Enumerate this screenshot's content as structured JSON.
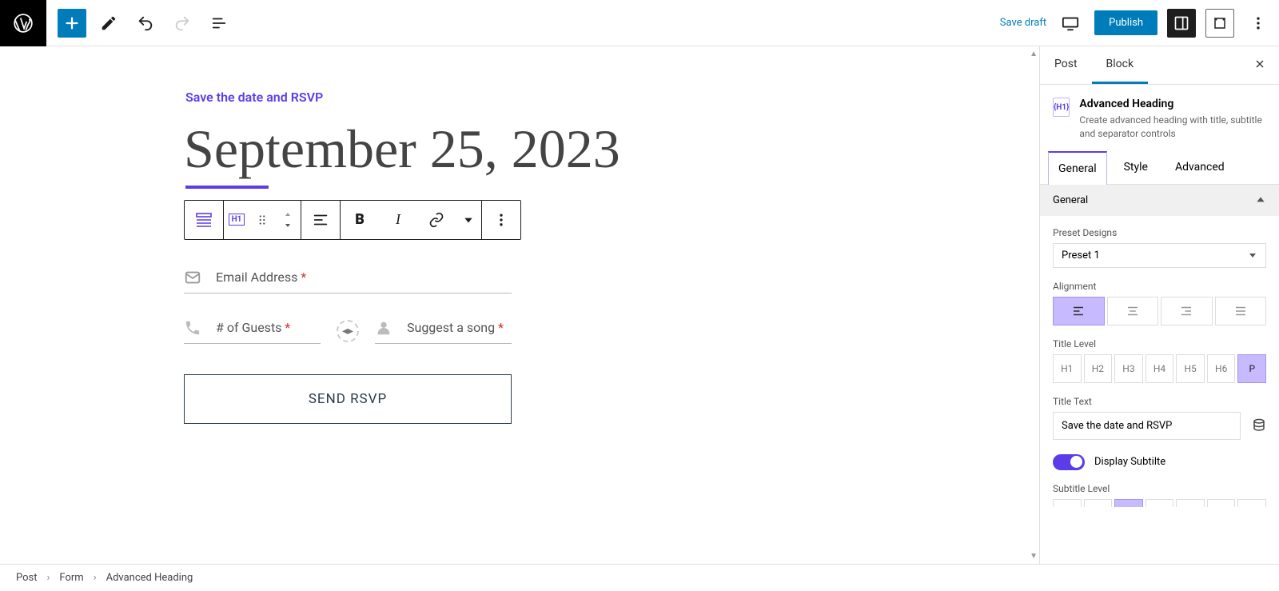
{
  "topbar": {
    "save_draft": "Save draft",
    "publish": "Publish"
  },
  "canvas": {
    "subtitle": "Save the date and RSVP",
    "heading": "September 25, 2023",
    "email_label": "Email Address",
    "guests_label": "# of Guests",
    "song_label": "Suggest a song",
    "required": "*",
    "send_btn": "SEND RSVP"
  },
  "sidebar": {
    "tabs": {
      "post": "Post",
      "block": "Block"
    },
    "block_name": "Advanced Heading",
    "block_desc": "Create advanced heading with title, subtitle and separator controls",
    "inner_tabs": {
      "general": "General",
      "style": "Style",
      "advanced": "Advanced"
    },
    "panel_general": "General",
    "preset_label": "Preset Designs",
    "preset_value": "Preset 1",
    "alignment_label": "Alignment",
    "title_level_label": "Title Level",
    "levels": [
      "H1",
      "H2",
      "H3",
      "H4",
      "H5",
      "H6",
      "P"
    ],
    "title_text_label": "Title Text",
    "title_text_value": "Save the date and RSVP",
    "display_subtitle_label": "Display Subtilte",
    "subtitle_level_label": "Subtitle Level"
  },
  "breadcrumb": {
    "a": "Post",
    "b": "Form",
    "c": "Advanced Heading"
  }
}
